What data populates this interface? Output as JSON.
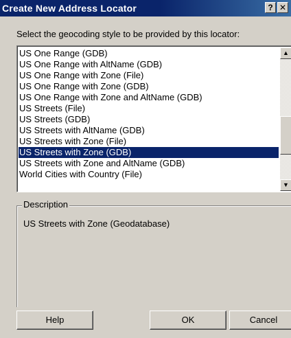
{
  "window": {
    "title": "Create New Address Locator",
    "help_glyph": "?",
    "close_glyph": "✕"
  },
  "prompt": "Select the geocoding style to be provided by this locator:",
  "styles": {
    "items": [
      "US One Range (GDB)",
      "US One Range with AltName (GDB)",
      "US One Range with Zone (File)",
      "US One Range with Zone (GDB)",
      "US One Range with Zone and AltName (GDB)",
      "US Streets (File)",
      "US Streets (GDB)",
      "US Streets with AltName (GDB)",
      "US Streets with Zone (File)",
      "US Streets with Zone (GDB)",
      "US Streets with Zone and AltName (GDB)",
      "World Cities with Country (File)"
    ],
    "selected": "US Streets with Zone (GDB)"
  },
  "description": {
    "legend": "Description",
    "text": "US Streets with Zone (Geodatabase)"
  },
  "buttons": {
    "help": "Help",
    "ok": "OK",
    "cancel": "Cancel"
  },
  "colors": {
    "titlebar": "#0a246a",
    "selection": "#0a246a",
    "face": "#d4d0c8"
  }
}
